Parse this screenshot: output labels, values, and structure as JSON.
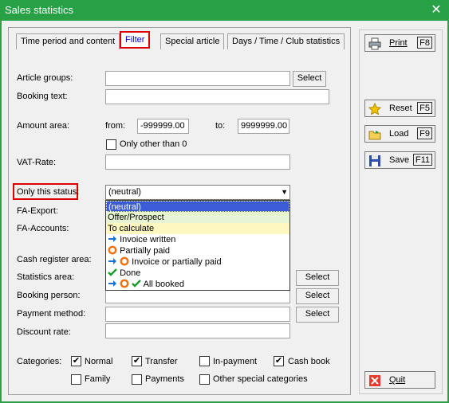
{
  "window": {
    "title": "Sales statistics",
    "close_glyph": "✕"
  },
  "tabs": [
    {
      "label": "Time period and content"
    },
    {
      "label": "Filter"
    },
    {
      "label": "Special article"
    },
    {
      "label": "Days / Time / Club statistics"
    }
  ],
  "form": {
    "article_groups_label": "Article groups:",
    "article_groups_value": "",
    "select_label": "Select",
    "booking_text_label": "Booking text:",
    "booking_text_value": "",
    "amount_area_label": "Amount area:",
    "from_label": "from:",
    "from_value": "-999999.00",
    "to_label": "to:",
    "to_value": "9999999.00",
    "only_other_than_zero_label": "Only other than 0",
    "vat_rate_label": "VAT-Rate:",
    "vat_rate_value": "",
    "only_this_status_label": "Only this status:",
    "status_value": "(neutral)",
    "fa_export_label": "FA-Export:",
    "fa_accounts_label": "FA-Accounts:",
    "cash_register_area_label": "Cash register area:",
    "statistics_area_label": "Statistics area:",
    "booking_person_label": "Booking person:",
    "payment_method_label": "Payment method:",
    "discount_rate_label": "Discount rate:",
    "categories_label": "Categories:"
  },
  "status_options": [
    {
      "label": "(neutral)",
      "icons": []
    },
    {
      "label": "Offer/Prospect",
      "icons": []
    },
    {
      "label": "To calculate",
      "icons": []
    },
    {
      "label": "Invoice written",
      "icons": [
        "arrow-right-icon"
      ]
    },
    {
      "label": "Partially paid",
      "icons": [
        "ring-icon"
      ]
    },
    {
      "label": "Invoice or partially paid",
      "icons": [
        "arrow-right-icon",
        "ring-icon"
      ]
    },
    {
      "label": "Done",
      "icons": [
        "checkmark-icon"
      ]
    },
    {
      "label": "All booked",
      "icons": [
        "arrow-right-icon",
        "ring-icon",
        "checkmark-icon"
      ]
    }
  ],
  "categories": [
    {
      "label": "Normal",
      "checked": true
    },
    {
      "label": "Transfer",
      "checked": true
    },
    {
      "label": "In-payment",
      "checked": false
    },
    {
      "label": "Cash book",
      "checked": true
    },
    {
      "label": "Family",
      "checked": false
    },
    {
      "label": "Payments",
      "checked": false
    },
    {
      "label": "Other special categories",
      "checked": false
    }
  ],
  "side_buttons": {
    "print": {
      "label": "Print",
      "key": "F8",
      "icon": "printer-icon"
    },
    "reset": {
      "label": "Reset",
      "key": "F5",
      "icon": "star-icon"
    },
    "load": {
      "label": "Load",
      "key": "F9",
      "icon": "folder-icon"
    },
    "save": {
      "label": "Save",
      "key": "F11",
      "icon": "floppy-disk-icon"
    },
    "quit": {
      "label": "Quit",
      "icon": "close-icon"
    }
  },
  "colors": {
    "titlebar": "#27a046",
    "highlight_box": "#dd0000",
    "selected_option": "#3c5bd6",
    "filter_tab_text": "#0000cc"
  }
}
